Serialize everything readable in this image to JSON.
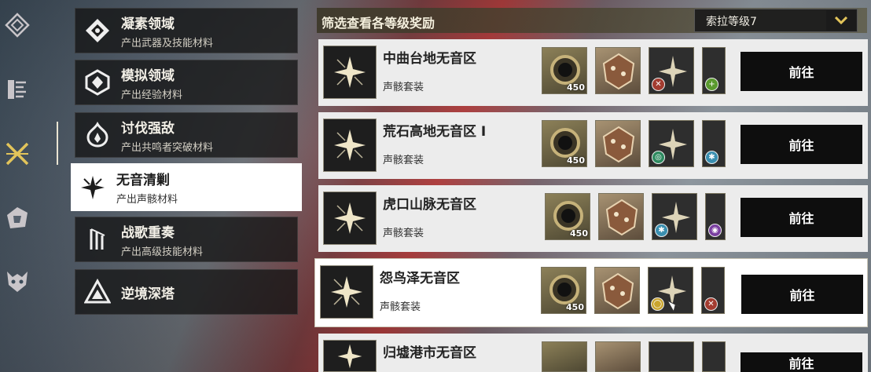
{
  "header": {
    "title": "筛选查看各等级奖励"
  },
  "level_select": {
    "value": "索拉等级7"
  },
  "sidebar": {
    "icons": [
      "diamond-nav-icon",
      "terminal-nav-icon",
      "crossed-swords-nav-icon",
      "paw-nav-icon",
      "mask-nav-icon"
    ]
  },
  "menu": {
    "items": [
      {
        "title": "凝素领域",
        "subtitle": "产出武器及技能材料"
      },
      {
        "title": "模拟领域",
        "subtitle": "产出经验材料"
      },
      {
        "title": "讨伐强敌",
        "subtitle": "产出共鸣者突破材料"
      },
      {
        "title": "无音清剿",
        "subtitle": "产出声骸材料"
      },
      {
        "title": "战歌重奏",
        "subtitle": "产出高级技能材料"
      },
      {
        "title": "逆境深塔",
        "subtitle": ""
      }
    ]
  },
  "rows": [
    {
      "name": "中曲台地无音区",
      "set": "声骸套装",
      "qty": "450",
      "go": "前往"
    },
    {
      "name": "荒石高地无音区 I",
      "set": "声骸套装",
      "qty": "450",
      "go": "前往"
    },
    {
      "name": "虎口山脉无音区",
      "set": "声骸套装",
      "qty": "450",
      "go": "前往"
    },
    {
      "name": "怨鸟泽无音区",
      "set": "声骸套装",
      "qty": "450",
      "go": "前往"
    },
    {
      "name": "归墟港市无音区",
      "set": "",
      "qty": "",
      "go": "前往"
    }
  ],
  "colors": {
    "active_menu": "#ffffff",
    "go_button": "#0e0e0e",
    "gold_accent": "#e2c45a"
  }
}
